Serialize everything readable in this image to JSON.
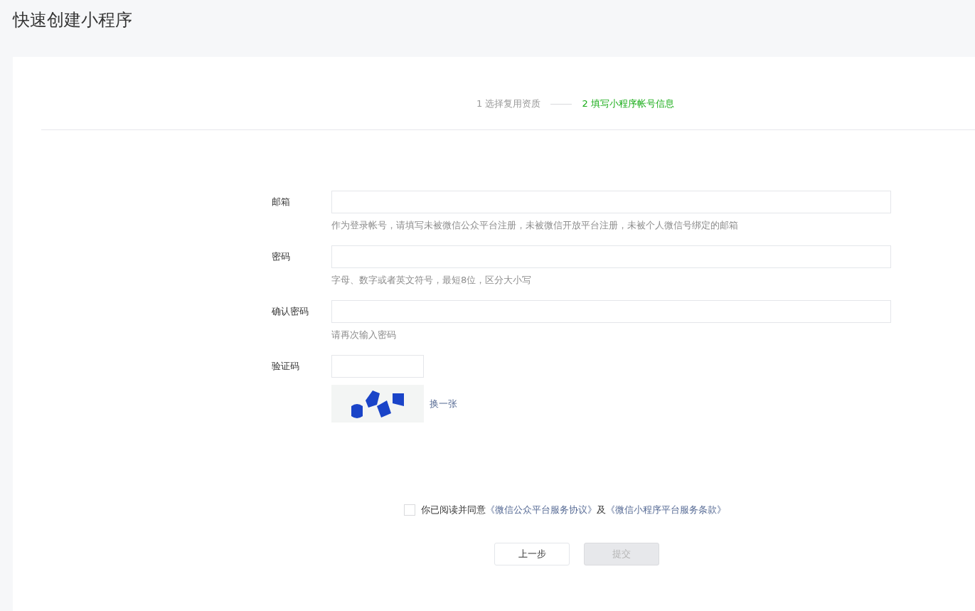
{
  "page_title": "快速创建小程序",
  "steps": [
    {
      "label": "1 选择复用资质",
      "selected": false
    },
    {
      "label": "2 填写小程序帐号信息",
      "selected": true
    }
  ],
  "fields": [
    {
      "kind": "text",
      "label": "邮箱",
      "hint": "作为登录帐号，请填写未被微信公众平台注册，未被微信开放平台注册，未被个人微信号绑定的邮箱"
    },
    {
      "kind": "password",
      "label": "密码",
      "hint": "字母、数字或者英文符号，最短8位，区分大小写"
    },
    {
      "kind": "password",
      "label": "确认密码",
      "hint": "请再次输入密码"
    },
    {
      "kind": "captcha",
      "label": "验证码",
      "refresh_link": "换一张"
    }
  ],
  "agreement": {
    "checked": false,
    "text": "你已阅读并同意",
    "link_1": "《微信公众平台服务协议》",
    "conjunction": "及",
    "link_2": "《微信小程序平台服务条款》"
  },
  "buttons": [
    {
      "label": "上一步",
      "disabled": false
    },
    {
      "label": "提交",
      "disabled": true
    }
  ]
}
